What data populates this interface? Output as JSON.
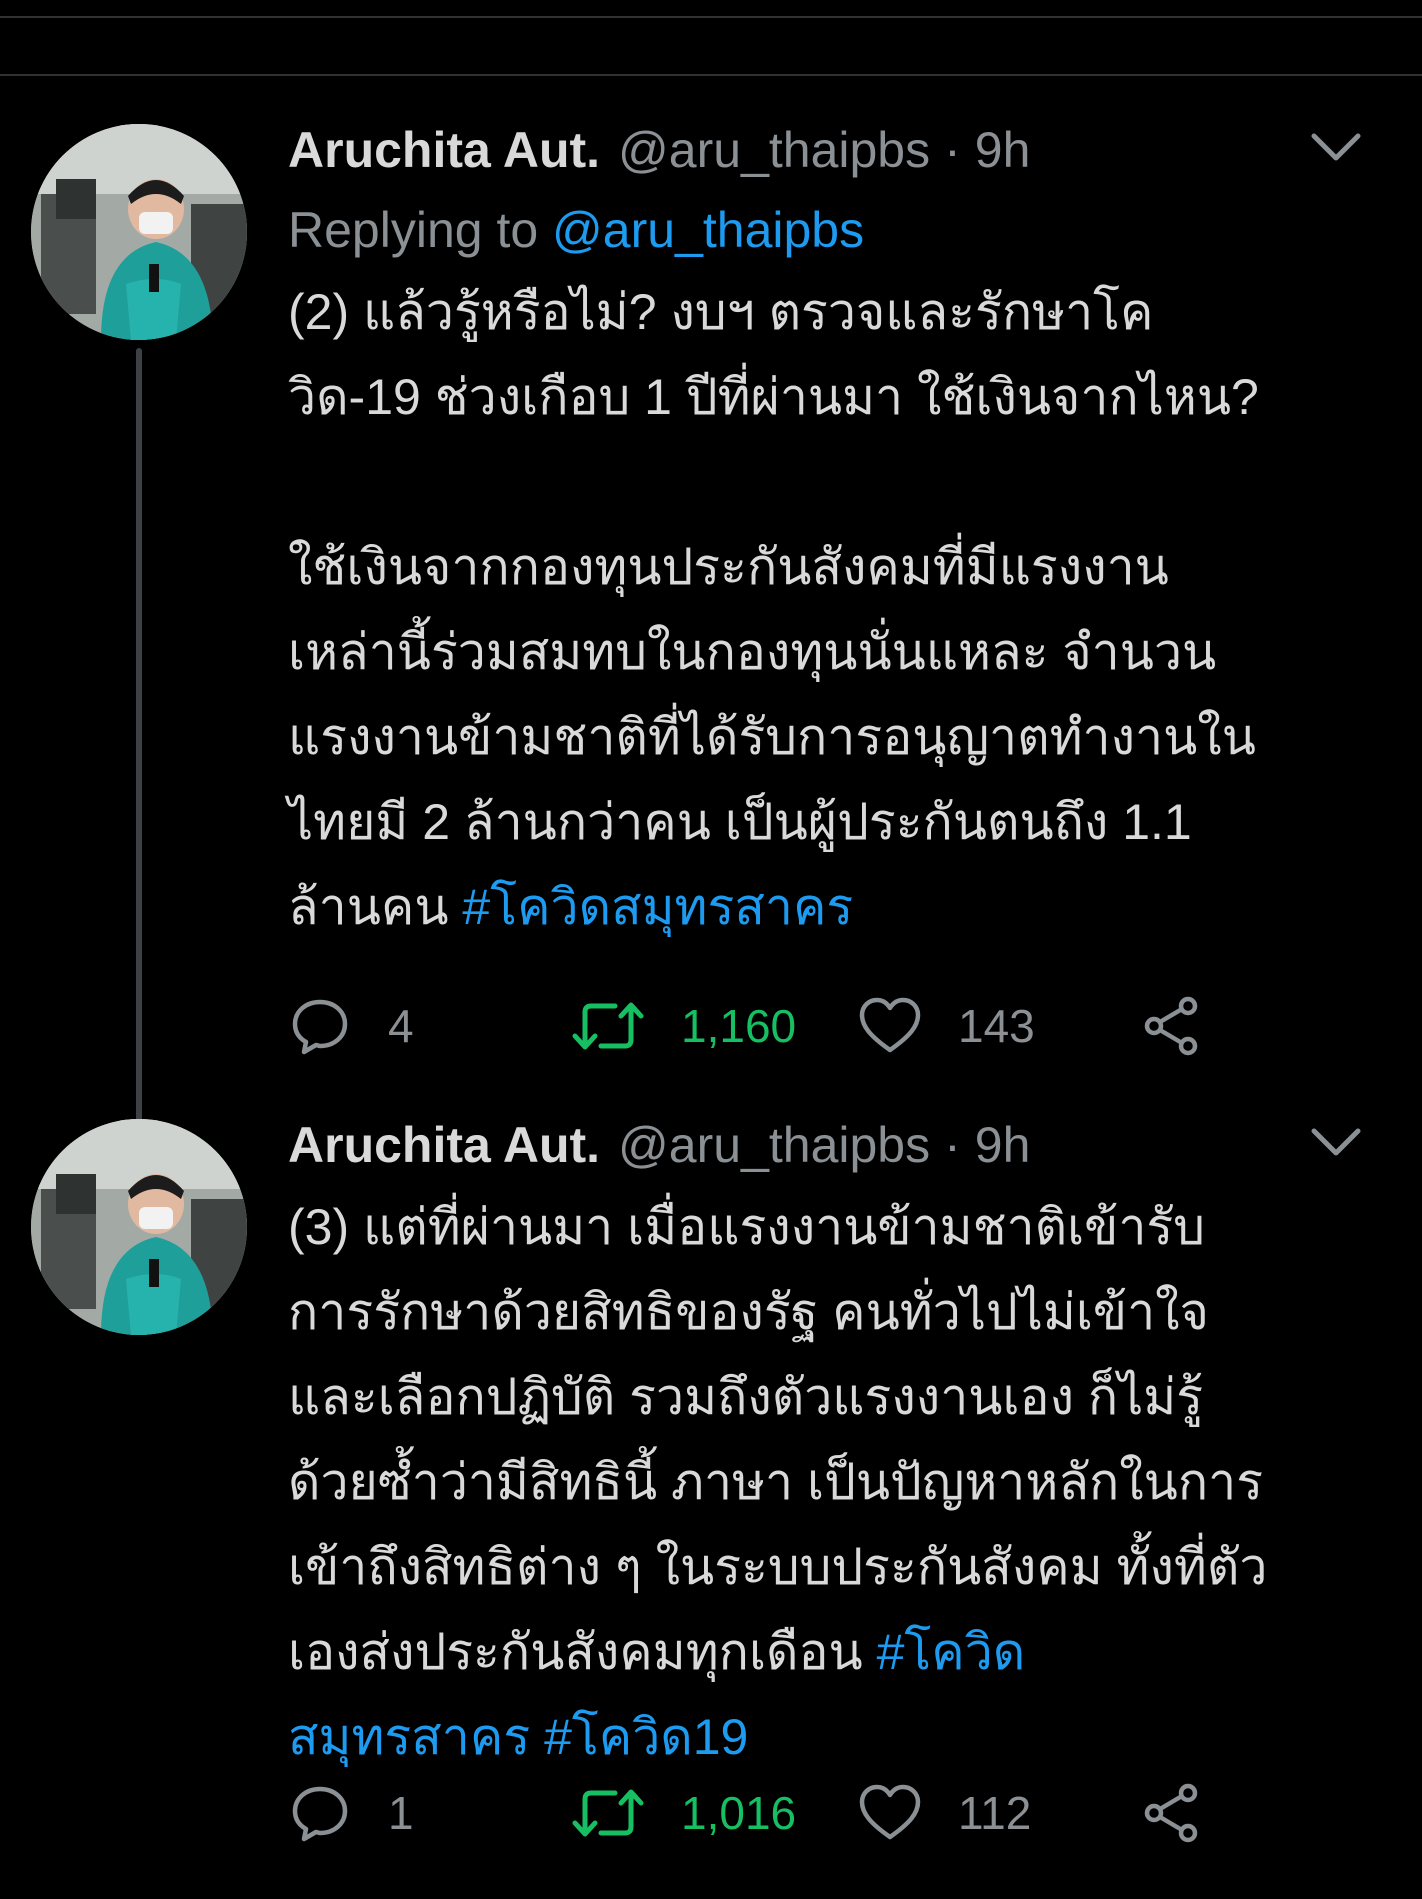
{
  "tweets": [
    {
      "display_name": "Aruchita Aut.",
      "handle": "@aru_thaipbs",
      "dot": "·",
      "time": "9h",
      "replying_prefix": "Replying to ",
      "replying_to": "@aru_thaipbs",
      "text": "(2) แล้วรู้หรือไม่? งบฯ ตรวจและรักษาโค\nวิด-19 ช่วงเกือบ 1 ปีที่ผ่านมา ใช้เงินจากไหน?\n\nใช้เงินจากกองทุนประกันสังคมที่มีแรงงาน\nเหล่านี้ร่วมสมทบในกองทุนนั่นแหละ จำนวน\nแรงงานข้ามชาติที่ได้รับการอนุญาตทำงานใน\nไทยมี 2 ล้านกว่าคน เป็นผู้ประกันตนถึง 1.1\nล้านคน ",
      "hashtags": "#โควิดสมุทรสาคร",
      "replies": "4",
      "retweets": "1,160",
      "likes": "143"
    },
    {
      "display_name": "Aruchita Aut.",
      "handle": "@aru_thaipbs",
      "dot": "·",
      "time": "9h",
      "text": "(3) แต่ที่ผ่านมา เมื่อแรงงานข้ามชาติเข้ารับ\nการรักษาด้วยสิทธิของรัฐ คนทั่วไปไม่เข้าใจ\nและเลือกปฏิบัติ รวมถึงตัวแรงงานเอง ก็ไม่รู้\nด้วยซ้ำว่ามีสิทธินี้ ภาษา เป็นปัญหาหลักในการ\nเข้าถึงสิทธิต่าง ๆ ในระบบประกันสังคม ทั้งที่ตัว\nเองส่งประกันสังคมทุกเดือน ",
      "hashtags": "#โควิด\nสมุทรสาคร #โควิด19",
      "replies": "1",
      "retweets": "1,016",
      "likes": "112"
    }
  ],
  "colors": {
    "background": "#000000",
    "text": "#d9d9d9",
    "muted": "#8b9095",
    "link": "#1d9bf0",
    "retweet_active": "#17bf63",
    "divider": "#2f3336"
  },
  "icons": {
    "menu": "chevron-down-icon",
    "reply": "speech-bubble-icon",
    "retweet": "retweet-arrows-icon",
    "like": "heart-icon",
    "share": "share-nodes-icon"
  }
}
